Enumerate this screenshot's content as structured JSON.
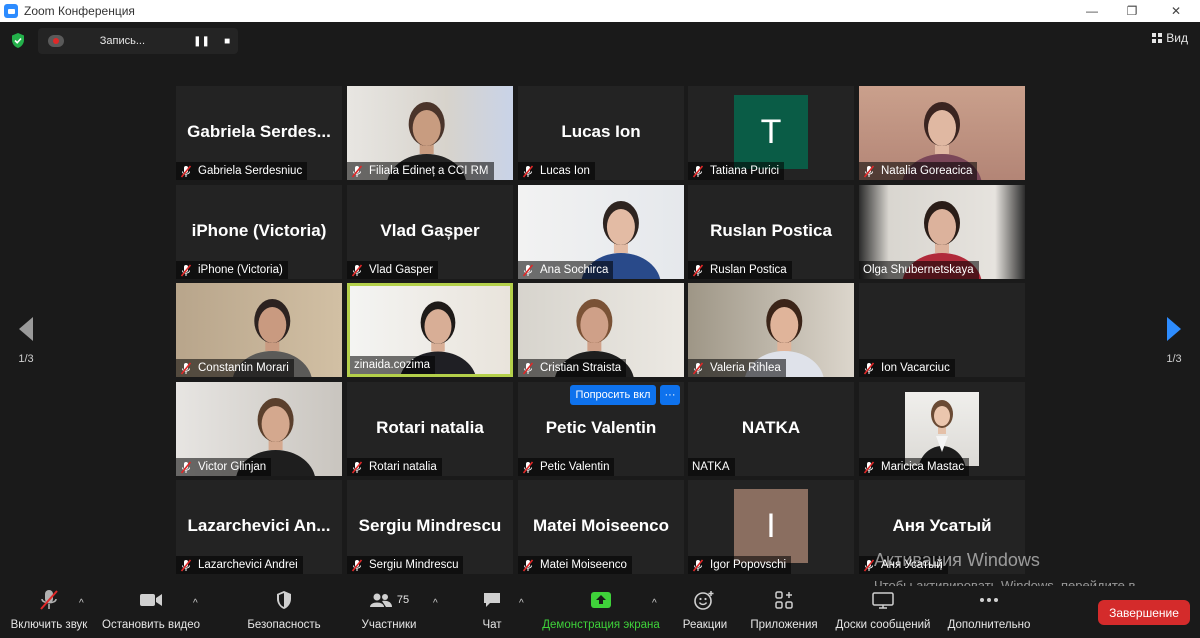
{
  "window": {
    "title": "Zoom Конференция",
    "minimize_glyph": "—",
    "maximize_glyph": "❐",
    "close_glyph": "✕"
  },
  "topbar": {
    "recording_label": "Запись...",
    "pause_glyph": "❚❚",
    "stop_glyph": "■",
    "view_label": "Вид",
    "security_shield_color": "#23b04a"
  },
  "pagination": {
    "left_label": "1/3",
    "right_label": "1/3",
    "left_arrow_color": "#9a9a9a",
    "right_arrow_color": "#2d8cff"
  },
  "participants": [
    {
      "name": "Gabriela Serdesniuc",
      "display": "Gabriela  Serdes...",
      "kind": "name",
      "muted": true
    },
    {
      "name": "Filiala Edineț a CCI RM",
      "display": "",
      "kind": "video",
      "muted": true
    },
    {
      "name": "Lucas Ion",
      "display": "Lucas Ion",
      "kind": "name",
      "muted": true
    },
    {
      "name": "Tatiana Purici",
      "display": "T",
      "kind": "avatar",
      "avatar_color": "#0a5c46",
      "muted": true
    },
    {
      "name": "Natalia Goreacica",
      "display": "",
      "kind": "video",
      "muted": true
    },
    {
      "name": "iPhone (Victoria)",
      "display": "iPhone (Victoria)",
      "kind": "name",
      "muted": true
    },
    {
      "name": "Vlad Gasper",
      "display": "Vlad Gașper",
      "kind": "name",
      "muted": true
    },
    {
      "name": "Ana Sochirca",
      "display": "",
      "kind": "video",
      "muted": true
    },
    {
      "name": "Ruslan Postica",
      "display": "Ruslan Postica",
      "kind": "name",
      "muted": true
    },
    {
      "name": "Olga Shubernetskaya",
      "display": "",
      "kind": "video",
      "muted": false
    },
    {
      "name": "Constantin Morari",
      "display": "",
      "kind": "video",
      "muted": true
    },
    {
      "name": "zinaida.cozima",
      "display": "",
      "kind": "video",
      "muted": false,
      "active": true
    },
    {
      "name": "Cristian Straista",
      "display": "",
      "kind": "video",
      "muted": true
    },
    {
      "name": "Valeria Rihlea",
      "display": "",
      "kind": "video",
      "muted": true
    },
    {
      "name": "Ion Vacarciuc",
      "display": "",
      "kind": "blank",
      "muted": true
    },
    {
      "name": "Victor Glinjan",
      "display": "",
      "kind": "video",
      "muted": true
    },
    {
      "name": "Rotari natalia",
      "display": "Rotari natalia",
      "kind": "name",
      "muted": true
    },
    {
      "name": "Petic Valentin",
      "display": "Petic Valentin",
      "kind": "name",
      "muted": true
    },
    {
      "name": "NATKA",
      "display": "NATKA",
      "kind": "name",
      "muted": false
    },
    {
      "name": "Maricica Mastac",
      "display": "",
      "kind": "photo",
      "muted": true
    },
    {
      "name": "Lazarchevici Andrei",
      "display": "Lazarchevici  An...",
      "kind": "name",
      "muted": true
    },
    {
      "name": "Sergiu Mindrescu",
      "display": "Sergiu Mindrescu",
      "kind": "name",
      "muted": true
    },
    {
      "name": "Matei Moiseenco",
      "display": "Matei Moiseenco",
      "kind": "name",
      "muted": true
    },
    {
      "name": "Igor Popovschi",
      "display": "I",
      "kind": "avatar",
      "avatar_color": "#8a6e60",
      "muted": true
    },
    {
      "name": "Аня Усатый",
      "display": "Аня Усатый",
      "kind": "name",
      "muted": true
    }
  ],
  "hover_actions": {
    "request_unmute_label": "Попросить вкл",
    "more_label": "···"
  },
  "watermark": {
    "line1": "Активация Windows",
    "line2": "Чтобы активировать Windows, перейдите в раздел \"Параметры\"."
  },
  "toolbar": {
    "unmute_label": "Включить звук",
    "stop_video_label": "Остановить видео",
    "security_label": "Безопасность",
    "participants_label": "Участники",
    "participants_count": "75",
    "chat_label": "Чат",
    "share_screen_label": "Демонстрация экрана",
    "reactions_label": "Реакции",
    "apps_label": "Приложения",
    "whiteboards_label": "Доски сообщений",
    "more_label": "Дополнительно",
    "end_label": "Завершение",
    "caret_glyph": "^"
  }
}
